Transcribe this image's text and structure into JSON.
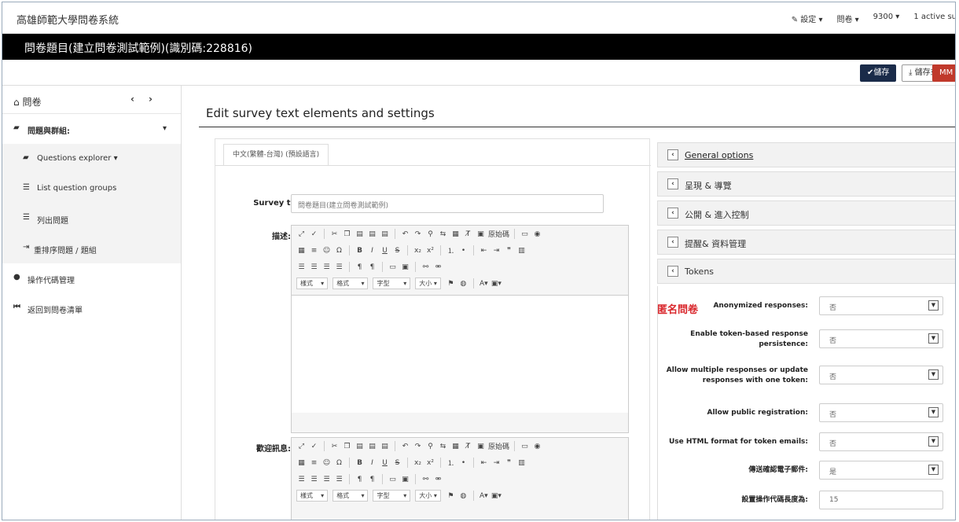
{
  "app": {
    "brand": "高雄師範大學問卷系統",
    "topnav": [
      "設定",
      "問卷",
      "9300",
      "1 active su"
    ]
  },
  "titlebar": {
    "title": "問卷題目(建立問卷測試範例)(識別碼:228816)"
  },
  "actions": {
    "save": "儲存",
    "save_close": "儲存並關閉",
    "red_button": "MM"
  },
  "sidebar": {
    "header": "問卷",
    "items": [
      {
        "label": "問題與群組:",
        "icon": "folder-open-icon"
      },
      {
        "label": "Questions explorer",
        "icon": "folder-open-icon"
      },
      {
        "label": "List question groups",
        "icon": "list-icon"
      },
      {
        "label": "列出問題",
        "icon": "list-icon"
      },
      {
        "label": "重排序問題 / 題組",
        "icon": "reorder-icon"
      },
      {
        "label": "操作代碼管理",
        "icon": "user-icon"
      },
      {
        "label": "返回到問卷清單",
        "icon": "step-backward-icon"
      }
    ]
  },
  "main": {
    "title": "Edit survey text elements and settings",
    "language_tab": "中文(繁體-台灣) (預設語言)",
    "survey_title_label": "Survey title:",
    "survey_title_value": "問卷題目(建立問卷測試範例)",
    "description_label": "描述:",
    "welcome_label": "歡迎訊息:",
    "toolbar": {
      "format_drop": "樣式",
      "format2_drop": "格式",
      "font_drop": "字型",
      "size_drop": "大小",
      "html_btn": "原始碼"
    }
  },
  "right": {
    "sections": [
      "General options",
      "呈現 & 導覽",
      "公開 & 進入控制",
      "提醒& 資料管理",
      "Tokens"
    ],
    "anon_note": "匿名問卷",
    "tokens": [
      {
        "label": "Anonymized responses:",
        "value": "否"
      },
      {
        "label": "Enable token-based response persistence:",
        "value": "否"
      },
      {
        "label": "Allow multiple responses or update responses with one token:",
        "value": "否"
      },
      {
        "label": "Allow public registration:",
        "value": "否"
      },
      {
        "label": "Use HTML format for token emails:",
        "value": "否"
      },
      {
        "label": "傳送確認電子郵件:",
        "value": "是"
      },
      {
        "label": "設置操作代碼長度為:",
        "value": "15"
      }
    ]
  },
  "colors": {
    "save_button": "#1a2b49",
    "anon_note": "#d9262b",
    "titlebar": "#000000"
  }
}
